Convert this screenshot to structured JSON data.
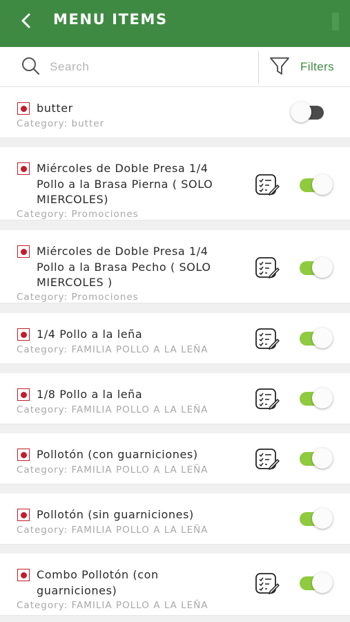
{
  "header": {
    "title": "MENU ITEMS",
    "back_icon": "chevron-left-icon",
    "bg_color": "#3f8a43"
  },
  "search": {
    "placeholder": "Search",
    "value": "",
    "filters_label": "Filters"
  },
  "colors": {
    "accent": "#3f8a43",
    "toggle_on": "#8fca3f",
    "toggle_off": "#4b4b4b",
    "veg_mark": "#c21d2a"
  },
  "items": [
    {
      "name": "butter",
      "category": "Category: butter",
      "enabled": false,
      "has_edit": false
    },
    {
      "name": "Miércoles de Doble Presa 1/4 Pollo a la Brasa Pierna ( SOLO MIERCOLES)",
      "category": "Category: Promociones",
      "enabled": true,
      "has_edit": true
    },
    {
      "name": "Miércoles de Doble Presa 1/4 Pollo a la Brasa Pecho ( SOLO MIERCOLES )",
      "category": "Category: Promociones",
      "enabled": true,
      "has_edit": true
    },
    {
      "name": "1/4 Pollo a la leña",
      "category": "Category: FAMILIA POLLO A LA LEÑA",
      "enabled": true,
      "has_edit": true
    },
    {
      "name": "1/8 Pollo a la leña",
      "category": "Category: FAMILIA POLLO A LA LEÑA",
      "enabled": true,
      "has_edit": true
    },
    {
      "name": "Pollotón (con guarniciones)",
      "category": "Category: FAMILIA POLLO A LA LEÑA",
      "enabled": true,
      "has_edit": true
    },
    {
      "name": "Pollotón (sin guarniciones)",
      "category": "Category: FAMILIA POLLO A LA LEÑA",
      "enabled": true,
      "has_edit": false
    },
    {
      "name": "Combo Pollotón (con guarniciones)",
      "category": "Category: FAMILIA POLLO A LA LEÑA",
      "enabled": true,
      "has_edit": true
    }
  ]
}
